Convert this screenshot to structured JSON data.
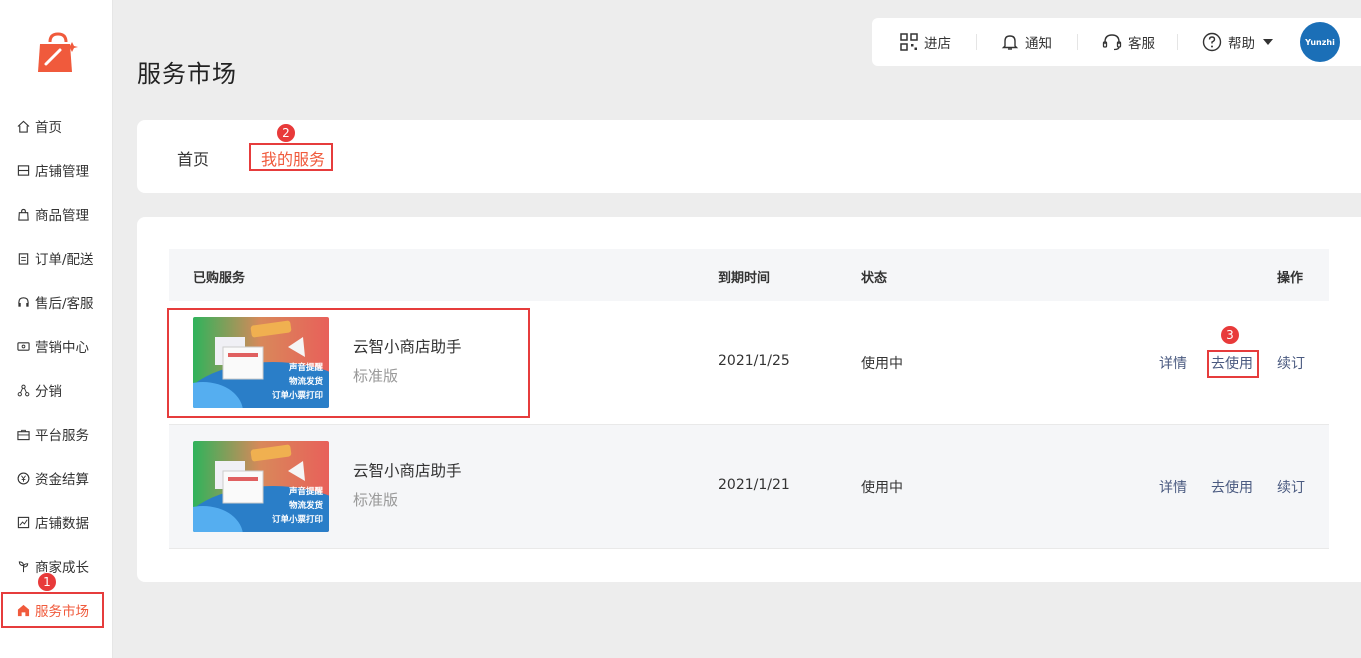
{
  "sidebar": {
    "items": [
      {
        "label": "首页",
        "icon": "home-icon"
      },
      {
        "label": "店铺管理",
        "icon": "store-icon"
      },
      {
        "label": "商品管理",
        "icon": "bag-icon"
      },
      {
        "label": "订单/配送",
        "icon": "clipboard-icon"
      },
      {
        "label": "售后/客服",
        "icon": "headset-icon"
      },
      {
        "label": "营销中心",
        "icon": "ticket-icon"
      },
      {
        "label": "分销",
        "icon": "share-icon"
      },
      {
        "label": "平台服务",
        "icon": "briefcase-icon"
      },
      {
        "label": "资金结算",
        "icon": "yuan-icon"
      },
      {
        "label": "店铺数据",
        "icon": "chart-icon"
      },
      {
        "label": "商家成长",
        "icon": "sprout-icon"
      },
      {
        "label": "服务市场",
        "icon": "market-icon",
        "active": true
      }
    ]
  },
  "header": {
    "title": "服务市场",
    "enter_store": "进店",
    "notify": "通知",
    "service": "客服",
    "help": "帮助",
    "avatar_text": "Yunzhi"
  },
  "tabs": {
    "home": "首页",
    "mine": "我的服务"
  },
  "badges": {
    "one": "1",
    "two": "2",
    "three": "3"
  },
  "table": {
    "headers": {
      "service": "已购服务",
      "expire": "到期时间",
      "status": "状态",
      "action": "操作"
    },
    "rows": [
      {
        "name": "云智小商店助手",
        "edition": "标准版",
        "expire": "2021/1/25",
        "status": "使用中",
        "details": "详情",
        "use": "去使用",
        "renew": "续订"
      },
      {
        "name": "云智小商店助手",
        "edition": "标准版",
        "expire": "2021/1/21",
        "status": "使用中",
        "details": "详情",
        "use": "去使用",
        "renew": "续订"
      }
    ],
    "thumb": {
      "line1": "声音提醒",
      "line2": "物流发货",
      "line3": "订单小票打印"
    }
  },
  "colors": {
    "accent": "#f05a3c",
    "highlight": "#e63c3c",
    "link": "#4a5a80"
  }
}
